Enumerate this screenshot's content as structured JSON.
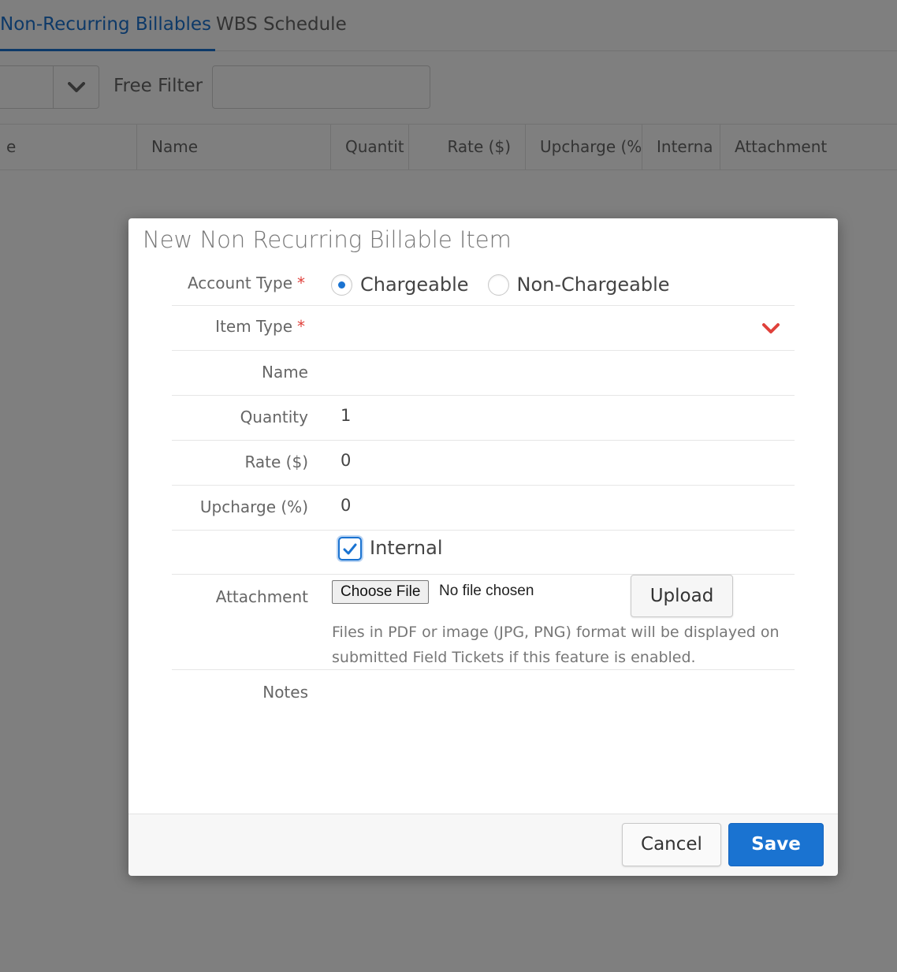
{
  "tabs": [
    {
      "label": "Non-Recurring Billables",
      "active": true
    },
    {
      "label": "WBS Schedule",
      "active": false
    }
  ],
  "filter": {
    "free_filter_label": "Free Filter",
    "free_filter_value": ""
  },
  "columns": [
    "e",
    "Name",
    "Quantit",
    "Rate ($)",
    "Upcharge (%",
    "Interna",
    "Attachment"
  ],
  "modal": {
    "title": "New Non Recurring Billable Item",
    "account_type": {
      "label": "Account Type",
      "required_mark": "*",
      "options": [
        "Chargeable",
        "Non-Chargeable"
      ],
      "selected": "Chargeable"
    },
    "item_type": {
      "label": "Item Type",
      "required_mark": "*",
      "value": ""
    },
    "name": {
      "label": "Name",
      "value": ""
    },
    "quantity": {
      "label": "Quantity",
      "value": "1"
    },
    "rate": {
      "label": "Rate ($)",
      "value": "0"
    },
    "upcharge": {
      "label": "Upcharge (%)",
      "value": "0"
    },
    "internal": {
      "label": "Internal",
      "checked": true
    },
    "attachment": {
      "label": "Attachment",
      "choose_file_label": "Choose File",
      "file_status": "No file chosen",
      "upload_label": "Upload",
      "hint": "Files in PDF or image (JPG, PNG) format will be displayed on submitted Field Tickets if this feature is enabled."
    },
    "notes": {
      "label": "Notes",
      "value": ""
    },
    "buttons": {
      "cancel": "Cancel",
      "save": "Save"
    }
  },
  "colors": {
    "accent": "#1a73d1",
    "required": "#e0413b",
    "overlay": "rgba(0,0,0,0.5)"
  },
  "icons": {
    "filter_dropdown": "chevron-down-icon",
    "item_type_dropdown": "chevron-down-icon",
    "internal_checkbox": "check-icon"
  }
}
